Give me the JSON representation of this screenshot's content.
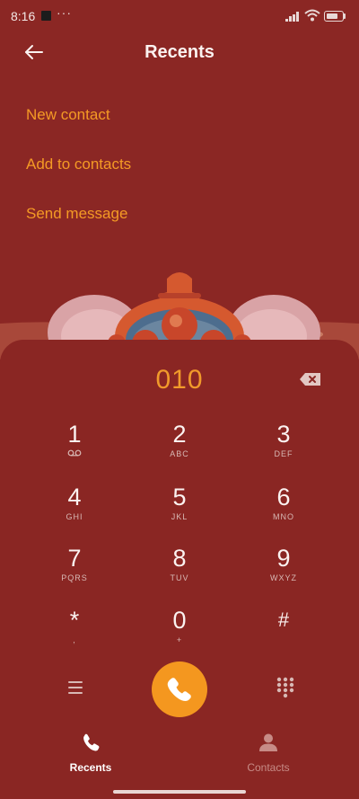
{
  "status_bar": {
    "time": "8:16",
    "more": "···",
    "battery_label": "100"
  },
  "header": {
    "title": "Recents"
  },
  "options": [
    {
      "label": "New contact"
    },
    {
      "label": "Add to contacts"
    },
    {
      "label": "Send message"
    }
  ],
  "dialpad": {
    "typed_number": "010",
    "keys": [
      {
        "digit": "1",
        "letters": ""
      },
      {
        "digit": "2",
        "letters": "ABC"
      },
      {
        "digit": "3",
        "letters": "DEF"
      },
      {
        "digit": "4",
        "letters": "GHI"
      },
      {
        "digit": "5",
        "letters": "JKL"
      },
      {
        "digit": "6",
        "letters": "MNO"
      },
      {
        "digit": "7",
        "letters": "PQRS"
      },
      {
        "digit": "8",
        "letters": "TUV"
      },
      {
        "digit": "9",
        "letters": "WXYZ"
      },
      {
        "digit": "*",
        "letters": ","
      },
      {
        "digit": "0",
        "letters": "+"
      },
      {
        "digit": "#",
        "letters": ""
      }
    ]
  },
  "bottom_nav": {
    "tabs": [
      {
        "label": "Recents",
        "active": true
      },
      {
        "label": "Contacts",
        "active": false
      }
    ]
  },
  "colors": {
    "background": "#8b2724",
    "accent": "#f4971f",
    "text": "#fbf2f0"
  }
}
